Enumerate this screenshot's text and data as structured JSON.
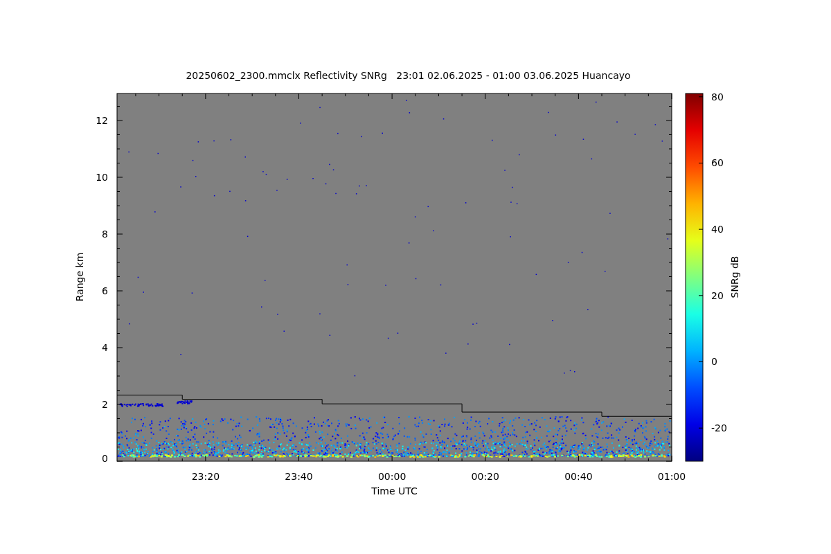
{
  "plot": {
    "title": "20250602_2300.mmclx Reflectivity SNRg   23:01 02.06.2025 - 01:00 03.06.2025 Huancayo",
    "xlabel": "Time UTC",
    "ylabel": "Range km",
    "xticks": [
      "23:20",
      "23:40",
      "00:00",
      "00:20",
      "00:40",
      "01:00"
    ],
    "yticks": [
      "12",
      "10",
      "8",
      "6",
      "4",
      "2",
      "0"
    ]
  },
  "colorbar": {
    "label": "SNRg dB",
    "ticks": [
      "80",
      "60",
      "40",
      "20",
      "0",
      "-20"
    ]
  }
}
